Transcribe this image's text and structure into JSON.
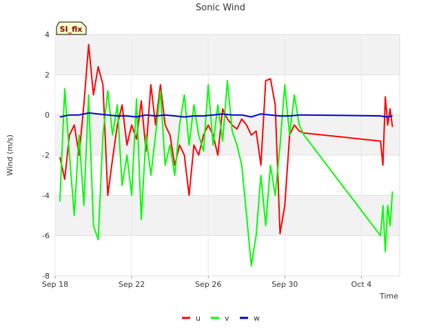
{
  "chart_data": {
    "type": "line",
    "title": "Sonic Wind",
    "xlabel": "Time",
    "ylabel": "Wind (m/s)",
    "station_tag": "SI_flx",
    "ylim": [
      -8,
      4
    ],
    "y_ticks": [
      -8,
      -6,
      -4,
      -2,
      0,
      2,
      4
    ],
    "x_ticks": [
      {
        "label": "Sep 18",
        "date": "2023-09-18"
      },
      {
        "label": "Sep 22",
        "date": "2023-09-22"
      },
      {
        "label": "Sep 26",
        "date": "2023-09-26"
      },
      {
        "label": "Sep 30",
        "date": "2023-09-30"
      },
      {
        "label": "Oct 4",
        "date": "2023-10-04"
      }
    ],
    "xlim": [
      "2023-09-18",
      "2023-10-06"
    ],
    "grid": true,
    "legend_position": "bottom-center",
    "series": [
      {
        "name": "u",
        "color": "#ff0000",
        "points": [
          [
            "2023-09-18T06:00",
            -2.1
          ],
          [
            "2023-09-18T12:00",
            -3.2
          ],
          [
            "2023-09-18T18:00",
            -1.0
          ],
          [
            "2023-09-19T00:00",
            -0.5
          ],
          [
            "2023-09-19T06:00",
            -2.0
          ],
          [
            "2023-09-19T12:00",
            0.5
          ],
          [
            "2023-09-19T18:00",
            3.5
          ],
          [
            "2023-09-20T00:00",
            1.0
          ],
          [
            "2023-09-20T06:00",
            2.4
          ],
          [
            "2023-09-20T12:00",
            1.5
          ],
          [
            "2023-09-20T18:00",
            -4.0
          ],
          [
            "2023-09-21T00:00",
            -2.2
          ],
          [
            "2023-09-21T06:00",
            -0.5
          ],
          [
            "2023-09-21T12:00",
            0.5
          ],
          [
            "2023-09-21T18:00",
            -1.5
          ],
          [
            "2023-09-22T00:00",
            -0.5
          ],
          [
            "2023-09-22T06:00",
            -1.2
          ],
          [
            "2023-09-22T12:00",
            0.7
          ],
          [
            "2023-09-22T18:00",
            -1.8
          ],
          [
            "2023-09-23T00:00",
            1.5
          ],
          [
            "2023-09-23T06:00",
            -0.5
          ],
          [
            "2023-09-23T12:00",
            1.5
          ],
          [
            "2023-09-23T18:00",
            -0.5
          ],
          [
            "2023-09-24T00:00",
            -1.0
          ],
          [
            "2023-09-24T06:00",
            -2.5
          ],
          [
            "2023-09-24T12:00",
            -1.5
          ],
          [
            "2023-09-24T18:00",
            -2.0
          ],
          [
            "2023-09-25T00:00",
            -4.0
          ],
          [
            "2023-09-25T06:00",
            -1.5
          ],
          [
            "2023-09-25T12:00",
            -2.0
          ],
          [
            "2023-09-25T18:00",
            -1.0
          ],
          [
            "2023-09-26T00:00",
            -0.5
          ],
          [
            "2023-09-26T06:00",
            -1.0
          ],
          [
            "2023-09-26T12:00",
            -2.0
          ],
          [
            "2023-09-26T18:00",
            0.3
          ],
          [
            "2023-09-27T00:00",
            -0.2
          ],
          [
            "2023-09-27T06:00",
            -0.5
          ],
          [
            "2023-09-27T12:00",
            -0.7
          ],
          [
            "2023-09-27T18:00",
            -0.2
          ],
          [
            "2023-09-28T00:00",
            -0.5
          ],
          [
            "2023-09-28T06:00",
            -1.0
          ],
          [
            "2023-09-28T12:00",
            -0.8
          ],
          [
            "2023-09-28T18:00",
            -2.5
          ],
          [
            "2023-09-29T00:00",
            1.7
          ],
          [
            "2023-09-29T06:00",
            1.8
          ],
          [
            "2023-09-29T12:00",
            0.5
          ],
          [
            "2023-09-29T18:00",
            -5.9
          ],
          [
            "2023-09-30T00:00",
            -4.5
          ],
          [
            "2023-09-30T06:00",
            -1.0
          ],
          [
            "2023-09-30T12:00",
            -0.5
          ],
          [
            "2023-09-30T18:00",
            -0.8
          ],
          [
            "2023-10-01T00:00",
            -0.9
          ],
          [
            "2023-10-05T00:00",
            -1.3
          ],
          [
            "2023-10-05T03:00",
            -2.5
          ],
          [
            "2023-10-05T06:00",
            0.9
          ],
          [
            "2023-10-05T09:00",
            -0.5
          ],
          [
            "2023-10-05T12:00",
            0.3
          ],
          [
            "2023-10-05T15:00",
            -0.6
          ]
        ]
      },
      {
        "name": "v",
        "color": "#00ff00",
        "points": [
          [
            "2023-09-18T06:00",
            -4.3
          ],
          [
            "2023-09-18T12:00",
            1.3
          ],
          [
            "2023-09-18T18:00",
            -2.0
          ],
          [
            "2023-09-19T00:00",
            -5.0
          ],
          [
            "2023-09-19T06:00",
            -1.0
          ],
          [
            "2023-09-19T12:00",
            -4.5
          ],
          [
            "2023-09-19T18:00",
            1.0
          ],
          [
            "2023-09-20T00:00",
            -5.5
          ],
          [
            "2023-09-20T06:00",
            -6.2
          ],
          [
            "2023-09-20T12:00",
            -1.0
          ],
          [
            "2023-09-20T18:00",
            1.2
          ],
          [
            "2023-09-21T00:00",
            -1.0
          ],
          [
            "2023-09-21T06:00",
            0.5
          ],
          [
            "2023-09-21T12:00",
            -3.5
          ],
          [
            "2023-09-21T18:00",
            -2.0
          ],
          [
            "2023-09-22T00:00",
            -4.0
          ],
          [
            "2023-09-22T06:00",
            0.8
          ],
          [
            "2023-09-22T12:00",
            -5.2
          ],
          [
            "2023-09-22T18:00",
            -1.0
          ],
          [
            "2023-09-23T00:00",
            -3.0
          ],
          [
            "2023-09-23T06:00",
            -1.0
          ],
          [
            "2023-09-23T12:00",
            1.2
          ],
          [
            "2023-09-23T18:00",
            -2.5
          ],
          [
            "2023-09-24T00:00",
            -1.5
          ],
          [
            "2023-09-24T06:00",
            -3.0
          ],
          [
            "2023-09-24T12:00",
            -0.5
          ],
          [
            "2023-09-24T18:00",
            1.0
          ],
          [
            "2023-09-25T00:00",
            -1.5
          ],
          [
            "2023-09-25T06:00",
            0.5
          ],
          [
            "2023-09-25T12:00",
            -1.0
          ],
          [
            "2023-09-25T18:00",
            -1.8
          ],
          [
            "2023-09-26T00:00",
            1.5
          ],
          [
            "2023-09-26T06:00",
            -1.5
          ],
          [
            "2023-09-26T12:00",
            0.5
          ],
          [
            "2023-09-26T18:00",
            -1.3
          ],
          [
            "2023-09-27T00:00",
            1.7
          ],
          [
            "2023-09-27T06:00",
            -0.8
          ],
          [
            "2023-09-27T12:00",
            -1.5
          ],
          [
            "2023-09-27T18:00",
            -2.5
          ],
          [
            "2023-09-28T00:00",
            -5.0
          ],
          [
            "2023-09-28T06:00",
            -7.5
          ],
          [
            "2023-09-28T12:00",
            -6.0
          ],
          [
            "2023-09-28T18:00",
            -3.0
          ],
          [
            "2023-09-29T00:00",
            -5.5
          ],
          [
            "2023-09-29T06:00",
            -2.5
          ],
          [
            "2023-09-29T12:00",
            -4.0
          ],
          [
            "2023-09-29T18:00",
            -1.5
          ],
          [
            "2023-09-30T00:00",
            1.5
          ],
          [
            "2023-09-30T06:00",
            -1.0
          ],
          [
            "2023-09-30T12:00",
            1.0
          ],
          [
            "2023-09-30T18:00",
            -0.5
          ],
          [
            "2023-10-01T00:00",
            -1.0
          ],
          [
            "2023-10-05T00:00",
            -6.0
          ],
          [
            "2023-10-05T03:00",
            -4.5
          ],
          [
            "2023-10-05T06:00",
            -6.8
          ],
          [
            "2023-10-05T09:00",
            -4.5
          ],
          [
            "2023-10-05T12:00",
            -5.5
          ],
          [
            "2023-10-05T15:00",
            -3.8
          ]
        ]
      },
      {
        "name": "w",
        "color": "#0000cc",
        "points": [
          [
            "2023-09-18T06:00",
            -0.1
          ],
          [
            "2023-09-18T18:00",
            0.0
          ],
          [
            "2023-09-19T06:00",
            0.0
          ],
          [
            "2023-09-19T18:00",
            0.1
          ],
          [
            "2023-09-20T06:00",
            0.05
          ],
          [
            "2023-09-20T18:00",
            0.0
          ],
          [
            "2023-09-21T06:00",
            -0.05
          ],
          [
            "2023-09-21T18:00",
            -0.05
          ],
          [
            "2023-09-22T06:00",
            -0.1
          ],
          [
            "2023-09-22T18:00",
            0.0
          ],
          [
            "2023-09-23T06:00",
            -0.05
          ],
          [
            "2023-09-23T18:00",
            0.0
          ],
          [
            "2023-09-24T06:00",
            -0.05
          ],
          [
            "2023-09-24T18:00",
            -0.1
          ],
          [
            "2023-09-25T06:00",
            -0.05
          ],
          [
            "2023-09-25T18:00",
            -0.05
          ],
          [
            "2023-09-26T06:00",
            0.0
          ],
          [
            "2023-09-26T18:00",
            0.05
          ],
          [
            "2023-09-27T06:00",
            0.0
          ],
          [
            "2023-09-27T18:00",
            0.0
          ],
          [
            "2023-09-28T06:00",
            -0.1
          ],
          [
            "2023-09-28T18:00",
            0.05
          ],
          [
            "2023-09-29T06:00",
            0.0
          ],
          [
            "2023-09-29T18:00",
            -0.05
          ],
          [
            "2023-09-30T06:00",
            -0.05
          ],
          [
            "2023-09-30T18:00",
            0.0
          ],
          [
            "2023-10-01T00:00",
            0.0
          ],
          [
            "2023-10-05T00:00",
            -0.05
          ],
          [
            "2023-10-05T08:00",
            -0.1
          ],
          [
            "2023-10-05T15:00",
            -0.05
          ]
        ]
      }
    ]
  }
}
